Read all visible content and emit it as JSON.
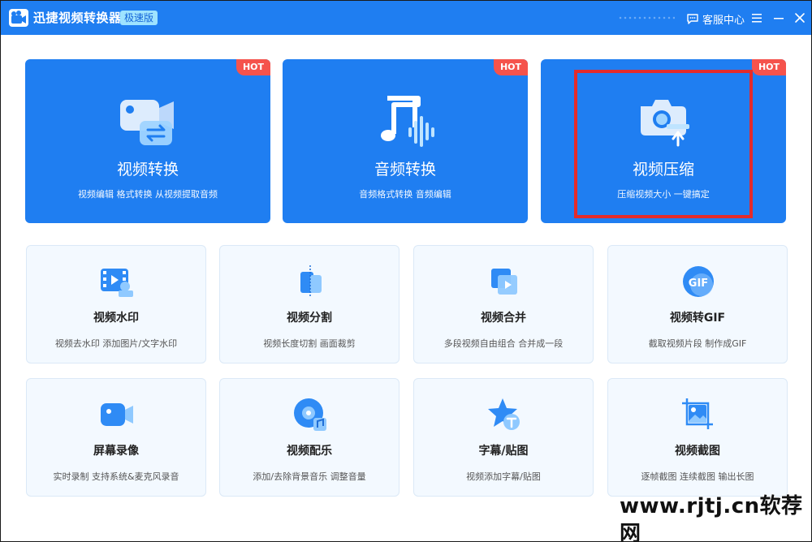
{
  "titlebar": {
    "app_title": "迅捷视频转换器",
    "edition": "极速版",
    "service_label": "客服中心"
  },
  "hot_label": "HOT",
  "hot_tiles": [
    {
      "title": "视频转换",
      "subtitle": "视频编辑 格式转换 从视频提取音频",
      "icon": "video-convert-icon"
    },
    {
      "title": "音频转换",
      "subtitle": "音频格式转换 音频编辑",
      "icon": "audio-convert-icon"
    },
    {
      "title": "视频压缩",
      "subtitle": "压缩视频大小 一键搞定",
      "icon": "video-compress-icon"
    }
  ],
  "tools": [
    {
      "title": "视频水印",
      "subtitle": "视频去水印 添加图片/文字水印",
      "icon": "watermark-icon"
    },
    {
      "title": "视频分割",
      "subtitle": "视频长度切割 画面裁剪",
      "icon": "split-icon"
    },
    {
      "title": "视频合并",
      "subtitle": "多段视频自由组合 合并成一段",
      "icon": "merge-icon"
    },
    {
      "title": "视频转GIF",
      "subtitle": "截取视频片段 制作成GIF",
      "icon": "gif-icon"
    },
    {
      "title": "屏幕录像",
      "subtitle": "实时录制 支持系统&麦克风录音",
      "icon": "screen-record-icon"
    },
    {
      "title": "视频配乐",
      "subtitle": "添加/去除背景音乐 调整音量",
      "icon": "music-icon"
    },
    {
      "title": "字幕/贴图",
      "subtitle": "视频添加字幕/贴图",
      "icon": "subtitle-icon"
    },
    {
      "title": "视频截图",
      "subtitle": "逐帧截图 连续截图 输出长图",
      "icon": "screenshot-icon"
    }
  ],
  "watermark_text": "www.rjtj.cn软荐网",
  "colors": {
    "brand": "#1f7ef1",
    "hot_badge": "#f5534c",
    "highlight": "#e32b2b",
    "tile_bg": "#f3f9ff"
  }
}
